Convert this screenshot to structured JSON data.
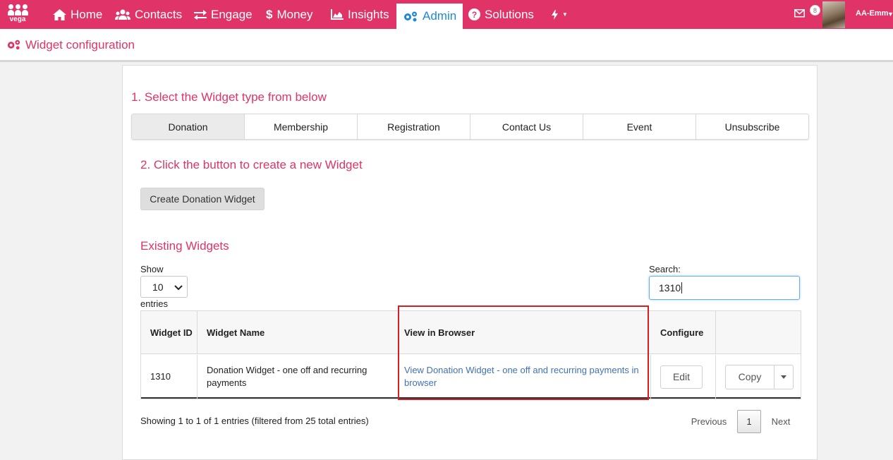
{
  "topnav": {
    "logo_text": "vega",
    "items": [
      {
        "label": "Home",
        "icon": "home-icon"
      },
      {
        "label": "Contacts",
        "icon": "users-icon"
      },
      {
        "label": "Engage",
        "icon": "exchange-icon"
      },
      {
        "label": "Money",
        "icon": "dollar-icon"
      },
      {
        "label": "Insights",
        "icon": "area-chart-icon"
      },
      {
        "label": "Admin",
        "icon": "cogs-icon",
        "active": true
      },
      {
        "label": "Solutions",
        "icon": "question-circle-icon"
      }
    ],
    "mail_count": "8",
    "user_name": "AA-Emm"
  },
  "subheader": {
    "title": "Widget configuration"
  },
  "step1": {
    "title": "1. Select the Widget type from below",
    "tabs": [
      "Donation",
      "Membership",
      "Registration",
      "Contact Us",
      "Event",
      "Unsubscribe"
    ],
    "selected": "Donation"
  },
  "step2": {
    "title": "2. Click the button to create a new Widget",
    "button": "Create Donation Widget"
  },
  "existing": {
    "title": "Existing Widgets",
    "show_label": "Show",
    "show_value": "10",
    "entries_label": "entries",
    "search_label": "Search:",
    "search_value": "1310",
    "columns": [
      "Widget ID",
      "Widget Name",
      "View in Browser",
      "Configure",
      ""
    ],
    "rows": [
      {
        "id": "1310",
        "name": "Donation Widget - one off and recurring payments",
        "view_link": "View Donation Widget - one off and recurring payments in browser",
        "edit": "Edit",
        "copy": "Copy"
      }
    ],
    "info": "Showing 1 to 1 of 1 entries (filtered from 25 total entries)",
    "pagination": {
      "previous": "Previous",
      "current": "1",
      "next": "Next"
    }
  },
  "colors": {
    "brand": "#e03367",
    "active_nav": "#1e88d8",
    "link": "#3f72b7",
    "highlight": "#d42020"
  }
}
